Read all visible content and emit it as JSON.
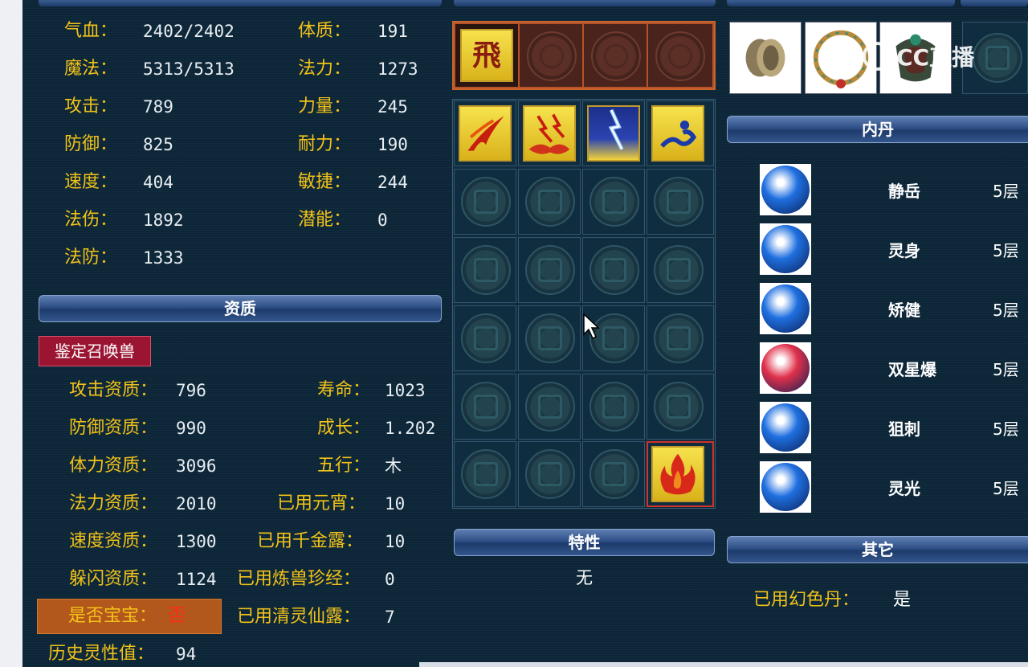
{
  "stats_left": [
    {
      "label": "气血：",
      "value": "2402/2402"
    },
    {
      "label": "魔法：",
      "value": "5313/5313"
    },
    {
      "label": "攻击：",
      "value": "789"
    },
    {
      "label": "防御：",
      "value": "825"
    },
    {
      "label": "速度：",
      "value": "404"
    },
    {
      "label": "法伤：",
      "value": "1892"
    },
    {
      "label": "法防：",
      "value": "1333"
    }
  ],
  "stats_right": [
    {
      "label": "体质：",
      "value": "191"
    },
    {
      "label": "法力：",
      "value": "1273"
    },
    {
      "label": "力量：",
      "value": "245"
    },
    {
      "label": "耐力：",
      "value": "190"
    },
    {
      "label": "敏捷：",
      "value": "244"
    },
    {
      "label": "潜能：",
      "value": "0"
    }
  ],
  "aptitude": {
    "header": "资质",
    "identify_button": "鉴定召唤兽",
    "left": [
      {
        "label": "攻击资质：",
        "value": "796"
      },
      {
        "label": "防御资质：",
        "value": "990"
      },
      {
        "label": "体力资质：",
        "value": "3096"
      },
      {
        "label": "法力资质：",
        "value": "2010"
      },
      {
        "label": "速度资质：",
        "value": "1300"
      },
      {
        "label": "躲闪资质：",
        "value": "1124"
      }
    ],
    "right": [
      {
        "label": "寿命：",
        "value": "1023"
      },
      {
        "label": "成长：",
        "value": "1.202"
      },
      {
        "label": "五行：",
        "value": "木"
      },
      {
        "label": "已用元宵：",
        "value": "10"
      },
      {
        "label": "已用千金露：",
        "value": "10"
      },
      {
        "label": "已用炼兽珍经：",
        "value": "0"
      },
      {
        "label": "已用清灵仙露：",
        "value": "7"
      }
    ],
    "baby_label": "是否宝宝：",
    "baby_value": "否",
    "spirit_label": "历史灵性值：",
    "spirit_value": "94"
  },
  "skills": {
    "icons": [
      "fei-rune-icon",
      "fire-claw-icon",
      "thunder-cloud-icon",
      "lightning-strike-icon",
      "blue-dragon-icon",
      "flame-icon"
    ]
  },
  "trait": {
    "header": "特性",
    "value": "无"
  },
  "neidan": {
    "header": "内丹",
    "items": [
      {
        "name": "静岳",
        "level": "5层",
        "color": "#1f6fe0",
        "icon": "mountain-orb-icon"
      },
      {
        "name": "灵身",
        "level": "5层",
        "color": "#1f6fe0",
        "icon": "dragon-orb-icon"
      },
      {
        "name": "矫健",
        "level": "5层",
        "color": "#1f6fe0",
        "icon": "water-orb-icon"
      },
      {
        "name": "双星爆",
        "level": "5层",
        "color": "#e0304a",
        "icon": "fire-orb-icon"
      },
      {
        "name": "狙刺",
        "level": "5层",
        "color": "#1f6fe0",
        "icon": "thunder-orb-icon"
      },
      {
        "name": "灵光",
        "level": "5层",
        "color": "#1f6fe0",
        "icon": "light-orb-icon"
      }
    ]
  },
  "other": {
    "header": "其它",
    "label": "已用幻色丹：",
    "value": "是"
  },
  "equipment": {
    "items": [
      "bracer-icon",
      "necklace-icon",
      "armor-icon"
    ]
  },
  "watermark": "CC直播"
}
